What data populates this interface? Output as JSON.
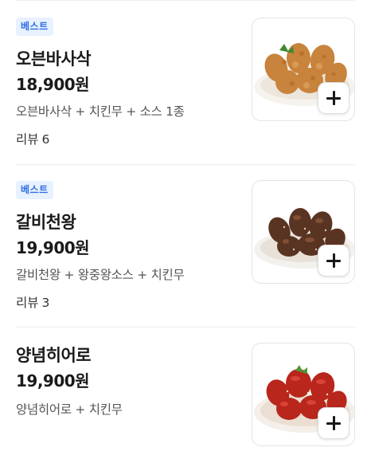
{
  "menu": {
    "items": [
      {
        "badge": "베스트",
        "name": "오븐바사삭",
        "price": "18,900원",
        "description": "오븐바사삭 + 치킨무 + 소스 1종",
        "review_label": "리뷰",
        "review_count": "6",
        "image": "oven-roasted-chicken-photo",
        "add_icon": "plus-icon"
      },
      {
        "badge": "베스트",
        "name": "갈비천왕",
        "price": "19,900원",
        "description": "갈비천왕 + 왕중왕소스 + 치킨무",
        "review_label": "리뷰",
        "review_count": "3",
        "image": "galbi-glazed-chicken-photo",
        "add_icon": "plus-icon"
      },
      {
        "name": "양념히어로",
        "price": "19,900원",
        "description": "양념히어로 + 치킨무",
        "image": "yangnyeom-chicken-photo",
        "add_icon": "plus-icon"
      }
    ]
  },
  "colors": {
    "badge_bg": "#e8f1ff",
    "badge_text": "#2f6fe4",
    "divider": "#ececec"
  }
}
